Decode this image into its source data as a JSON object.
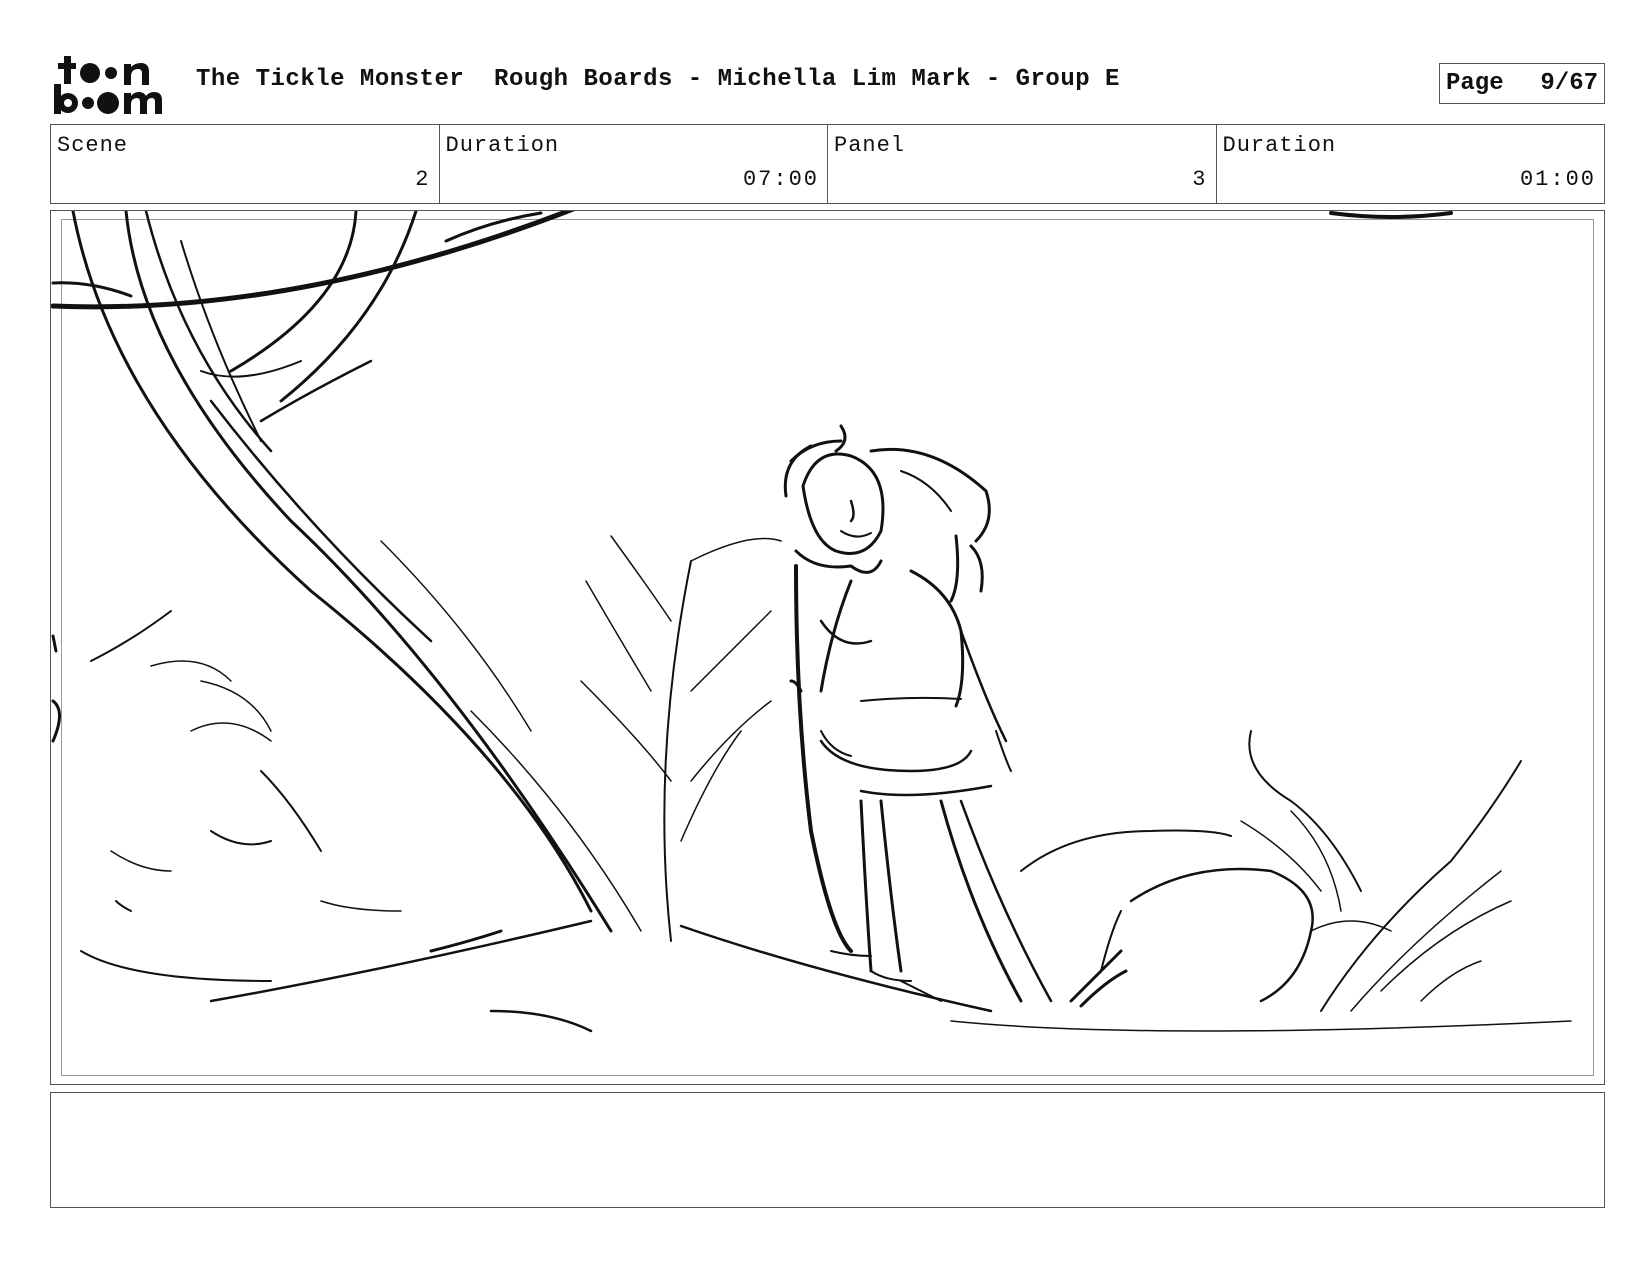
{
  "header": {
    "logo_text": "toon boom",
    "title": "The Tickle Monster  Rough Boards - Michella Lim Mark - Group E",
    "page_label": "Page",
    "page_number": "9/67"
  },
  "info": {
    "scene_label": "Scene",
    "scene_value": "2",
    "scene_duration_label": "Duration",
    "scene_duration_value": "07:00",
    "panel_label": "Panel",
    "panel_value": "3",
    "panel_duration_label": "Duration",
    "panel_duration_value": "01:00"
  },
  "notes": {
    "text": ""
  }
}
